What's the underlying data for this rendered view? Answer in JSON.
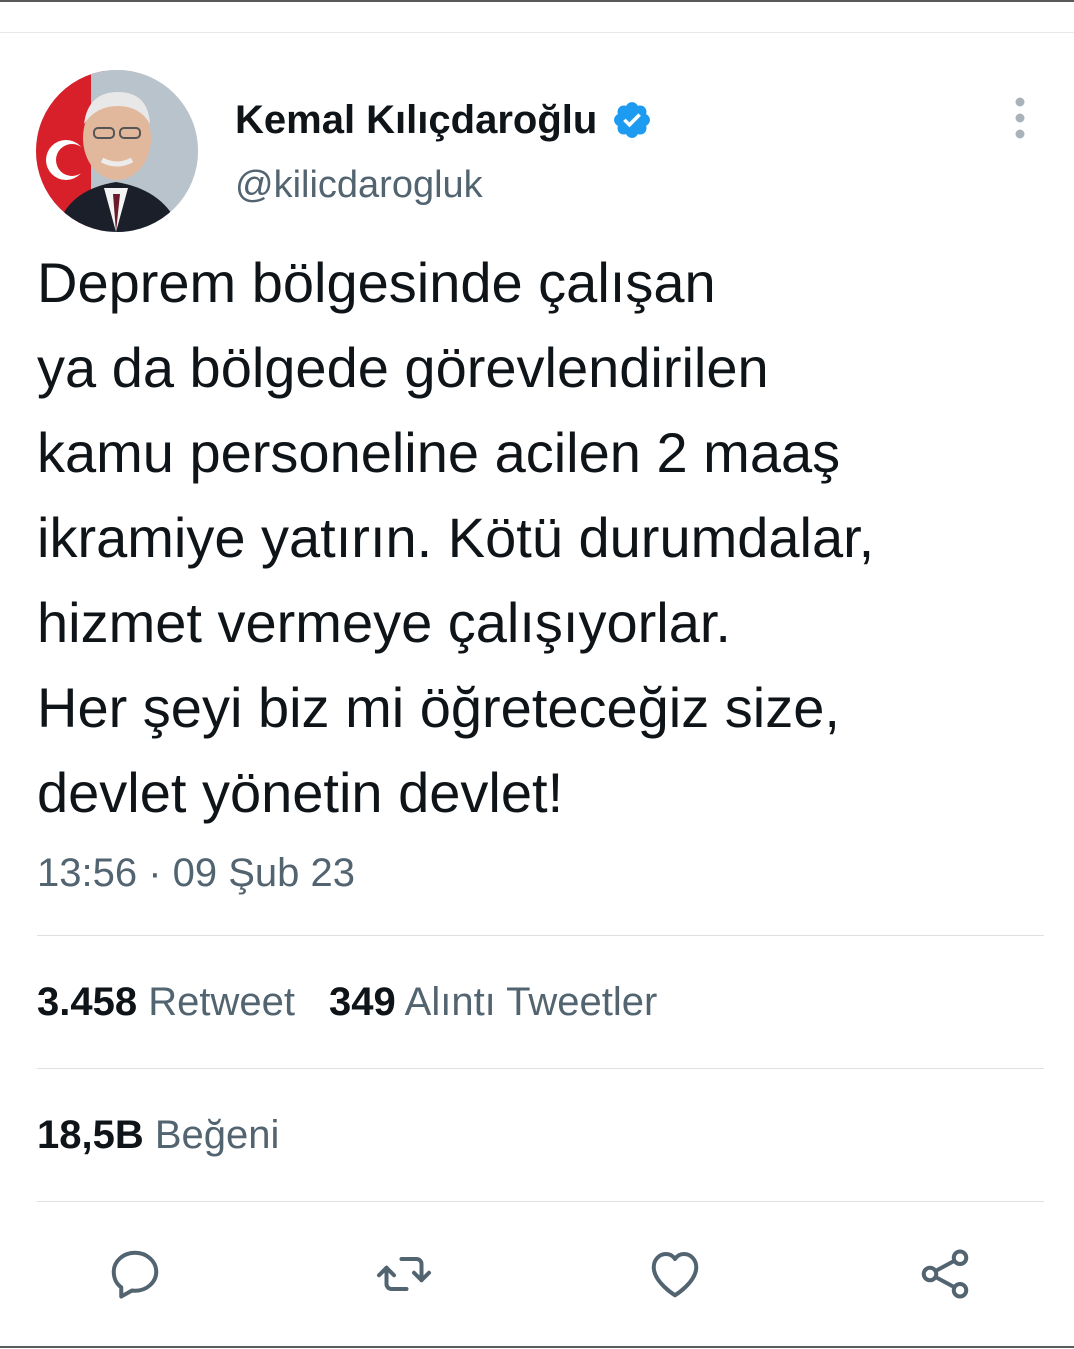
{
  "author": {
    "display_name": "Kemal Kılıçdaroğlu",
    "handle": "@kilicdarogluk",
    "verified": true
  },
  "tweet": {
    "lines": [
      "Deprem bölgesinde çalışan",
      "ya da bölgede görevlendirilen",
      "kamu personeline acilen 2 maaş",
      "ikramiye yatırın. Kötü durumdalar,",
      "hizmet vermeye çalışıyorlar.",
      "Her şeyi biz mi öğreteceğiz size,",
      "devlet yönetin devlet!"
    ],
    "timestamp": "13:56 · 09 Şub 23"
  },
  "stats": {
    "retweets_count": "3.458",
    "retweets_label": "Retweet",
    "quotes_count": "349",
    "quotes_label": "Alıntı Tweetler",
    "likes_count": "18,5B",
    "likes_label": "Beğeni"
  },
  "actions": [
    "reply-icon",
    "retweet-icon",
    "like-icon",
    "share-icon"
  ],
  "colors": {
    "text": "#0f1419",
    "secondary": "#536471",
    "verified": "#1d9bf0",
    "divider": "#dde1e4"
  }
}
